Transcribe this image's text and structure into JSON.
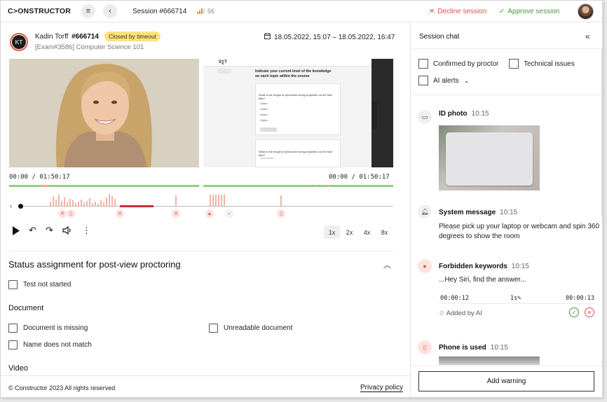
{
  "header": {
    "logo": "C>ONSTRUCTOR",
    "session_title": "Session #666714",
    "score": "56",
    "decline_label": "Decline session",
    "approve_label": "Approve session"
  },
  "student": {
    "initials": "KT",
    "name": "Kadin Torff",
    "id": "#666714",
    "status": "Closed by timeout",
    "exam": "[Exam#3586] Computer Science 101",
    "date_range": "18.05.2022, 15:07 – 18.05.2022, 16:47"
  },
  "screen_share": {
    "brand": "S∑T",
    "heading": "Indicate your current level of the knowledge on each topic within the course",
    "question": "What is the length of pendulum string projection on the floor tiles?",
    "options": [
      "Option",
      "Option",
      "Option",
      "Option"
    ],
    "answer_placeholder": "Your answer"
  },
  "player": {
    "time_left": "00:00 / 01:50:17",
    "time_right": "00:00 / 01:50:17",
    "speeds": [
      "1x",
      "2x",
      "4x",
      "8x"
    ],
    "active_speed": "1x"
  },
  "status_section": {
    "title": "Status assignment for post-view proctoring",
    "test_not_started": "Test not started",
    "document_label": "Document",
    "document_missing": "Document is missing",
    "unreadable_document": "Unreadable document",
    "name_mismatch": "Name does not match",
    "video_label": "Video"
  },
  "footer": {
    "copyright": "© Constructor 2023 All rights reserved",
    "privacy": "Privacy policy"
  },
  "chat": {
    "title": "Session chat",
    "filters": {
      "confirmed": "Confirmed by proctor",
      "technical": "Technical issues",
      "ai_alerts": "AI alerts"
    },
    "messages": {
      "id_photo": {
        "title": "ID photo",
        "time": "10:15"
      },
      "system": {
        "title": "System message",
        "time": "10:15",
        "text": "Please pick up your laptop or webcam and spin 360 degrees to show the room"
      },
      "keywords": {
        "title": "Forbidden keywords",
        "time": "10:15",
        "text": "...Hey Siri, find the answer...",
        "start": "00:00:12",
        "duration": "1s",
        "end": "00:00:13",
        "added_by": "Added by AI"
      },
      "phone": {
        "title": "Phone is used",
        "time": "10:15"
      }
    },
    "add_warning": "Add warning"
  }
}
